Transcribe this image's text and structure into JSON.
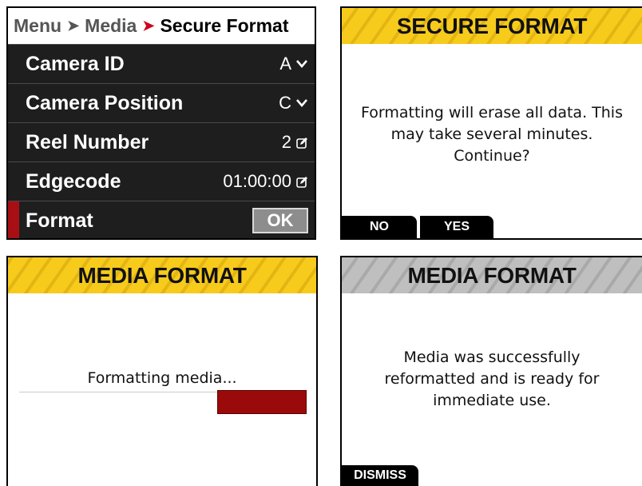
{
  "menu": {
    "breadcrumb": {
      "item1": "Menu",
      "item2": "Media",
      "current": "Secure Format"
    },
    "rows": [
      {
        "label": "Camera ID",
        "value": "A",
        "icon": "chevron-down-icon"
      },
      {
        "label": "Camera Position",
        "value": "C",
        "icon": "chevron-down-icon"
      },
      {
        "label": "Reel Number",
        "value": "2",
        "icon": "edit-icon"
      },
      {
        "label": "Edgecode",
        "value": "01:00:00",
        "icon": "edit-icon"
      }
    ],
    "format_row": {
      "label": "Format",
      "button": "OK"
    }
  },
  "secure_dialog": {
    "title": "SECURE FORMAT",
    "message_lines": [
      "Formatting will erase all data. This",
      "may take several minutes.",
      "Continue?"
    ],
    "no_label": "NO",
    "yes_label": "YES"
  },
  "progress_dialog": {
    "title": "MEDIA FORMAT",
    "message": "Formatting media...",
    "progress_fraction": 0.31
  },
  "done_dialog": {
    "title": "MEDIA FORMAT",
    "message_lines": [
      "Media was successfully",
      "reformatted and is ready for",
      "immediate use."
    ],
    "dismiss_label": "DISMISS"
  },
  "colors": {
    "hazard_yellow": "#f7cb1c",
    "hazard_gray": "#bfbfbf",
    "accent_red": "#a80f14",
    "menu_bg": "#1e1e1e"
  }
}
